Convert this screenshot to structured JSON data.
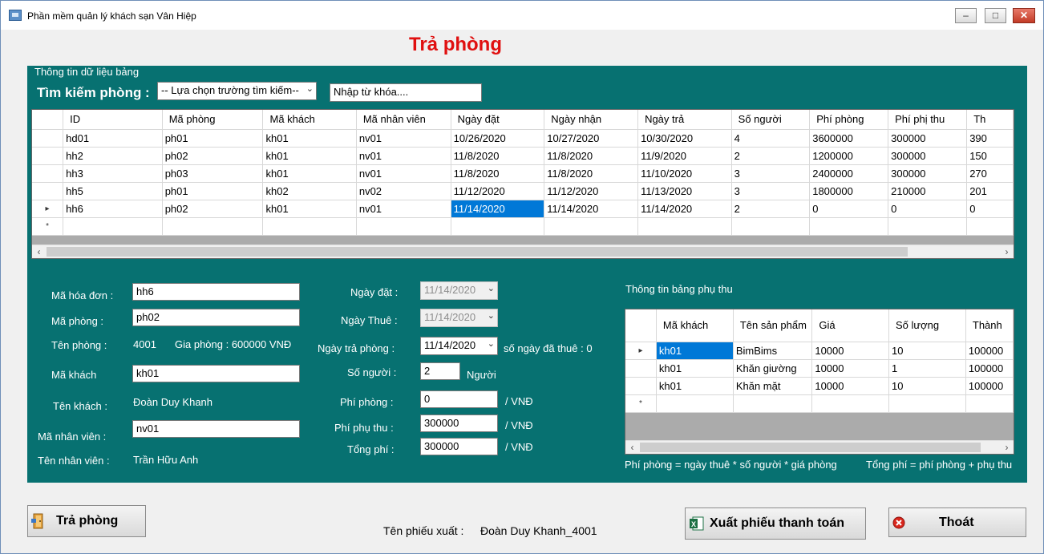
{
  "window": {
    "title": "Phần mềm quản lý khách sạn Vân Hiệp"
  },
  "page_title": "Trả phòng",
  "panel": {
    "legend": "Thông tin dữ liệu  bảng"
  },
  "search": {
    "label": "Tìm kiếm phòng :",
    "field_select": "-- Lựa chọn trường tìm kiếm--",
    "keyword_value": "Nhập từ khóa...."
  },
  "main_grid": {
    "columns": [
      "ID",
      "Mã phòng",
      "Mã khách",
      "Mã nhân viên",
      "Ngày đặt",
      "Ngày nhận",
      "Ngày trả",
      "Số người",
      "Phí phòng",
      "Phí phị thu",
      "Th"
    ],
    "rows": [
      [
        "hd01",
        "ph01",
        "kh01",
        "nv01",
        "10/26/2020",
        "10/27/2020",
        "10/30/2020",
        "4",
        "3600000",
        "300000",
        "390"
      ],
      [
        "hh2",
        "ph02",
        "kh01",
        "nv01",
        "11/8/2020",
        "11/8/2020",
        "11/9/2020",
        "2",
        "1200000",
        "300000",
        "150"
      ],
      [
        "hh3",
        "ph03",
        "kh01",
        "nv01",
        "11/8/2020",
        "11/8/2020",
        "11/10/2020",
        "3",
        "2400000",
        "300000",
        "270"
      ],
      [
        "hh5",
        "ph01",
        "kh02",
        "nv02",
        "11/12/2020",
        "11/12/2020",
        "11/13/2020",
        "3",
        "1800000",
        "210000",
        "201"
      ],
      [
        "hh6",
        "ph02",
        "kh01",
        "nv01",
        "11/14/2020",
        "11/14/2020",
        "11/14/2020",
        "2",
        "0",
        "0",
        "0"
      ]
    ],
    "current_row_marker": "▸",
    "new_row_marker": "*"
  },
  "form": {
    "ma_hoa_don_label": "Mã hóa đơn :",
    "ma_hoa_don_value": "hh6",
    "ma_phong_label": "Mã phòng :",
    "ma_phong_value": "ph02",
    "ten_phong_label": "Tên phòng :",
    "ten_phong_value": "4001",
    "gia_phong_text": "Gia phòng :  600000 VNĐ",
    "ma_khach_label": "Mã khách",
    "ma_khach_value": "kh01",
    "ten_khach_label": "Tên khách :",
    "ten_khach_value": "Đoàn Duy Khanh",
    "ma_nhan_vien_label": "Mã nhân viên :",
    "ma_nhan_vien_value": "nv01",
    "ten_nhan_vien_label": "Tên nhân viên :",
    "ten_nhan_vien_value": "Trần Hữu Anh",
    "ngay_dat_label": "Ngày đặt :",
    "ngay_dat_value": "11/14/2020",
    "ngay_thue_label": "Ngày Thuê :",
    "ngay_thue_value": "11/14/2020",
    "ngay_tra_label": "Ngày trả phòng :",
    "ngay_tra_value": "11/14/2020",
    "so_ngay_text": "số ngày đã thuê :  0",
    "so_nguoi_label": "Số người :",
    "so_nguoi_value": "2",
    "nguoi_unit": "Người",
    "phi_phong_label": "Phí phòng :",
    "phi_phong_value": "0",
    "phi_phu_thu_label": "Phí phụ thu :",
    "phi_phu_thu_value": "300000",
    "tong_phi_label": "Tổng phí :",
    "tong_phi_value": "300000",
    "vnd_unit": "/ VNĐ"
  },
  "surcharge": {
    "title": "Thông tin bảng phụ thu",
    "columns": [
      "Mã khách",
      "Tên sản phẩm",
      "Giá",
      "Số lượng",
      "Thành"
    ],
    "rows": [
      [
        "kh01",
        "BimBims",
        "10000",
        "10",
        "100000"
      ],
      [
        "kh01",
        "Khăn giường",
        "10000",
        "1",
        "100000"
      ],
      [
        "kh01",
        "Khăn mặt",
        "10000",
        "10",
        "100000"
      ]
    ],
    "formula_left": "Phí phòng = ngày thuê * số người * giá phòng",
    "formula_right": "Tổng phí = phí phòng + phụ thu"
  },
  "buttons": {
    "checkout": "Trả phòng",
    "export": "Xuất phiếu thanh toán",
    "exit": "Thoát"
  },
  "receipt": {
    "label": "Tên phiếu xuất :",
    "value": "Đoàn Duy Khanh_4001"
  },
  "colors": {
    "panel": "#077171",
    "title_red": "#e01010",
    "selection": "#0078d7"
  }
}
